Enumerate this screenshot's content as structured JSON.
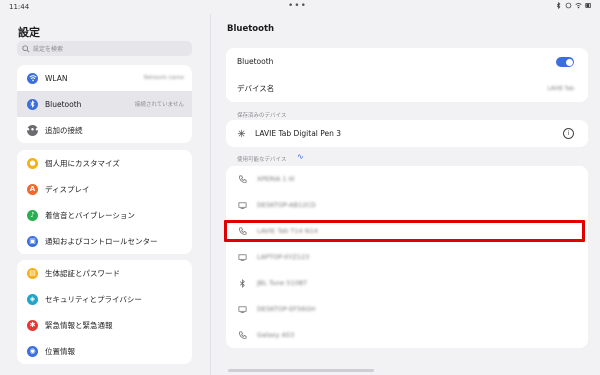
{
  "status": {
    "time": "11:44"
  },
  "sidebar": {
    "title": "設定",
    "search_placeholder": "設定を検索",
    "group1": [
      {
        "label": "WLAN",
        "value": "Network name",
        "icon": "wifi-icon",
        "color": "#3b6fde"
      },
      {
        "label": "Bluetooth",
        "value": "接続されていません",
        "icon": "bluetooth-icon",
        "color": "#3b6fde"
      },
      {
        "label": "追加の接続",
        "value": "",
        "icon": "more-icon",
        "color": "#6c6c70"
      }
    ],
    "group2": [
      {
        "label": "個人用にカスタマイズ",
        "icon": "palette-icon",
        "color": "#f3b01b"
      },
      {
        "label": "ディスプレイ",
        "icon": "display-icon",
        "color": "#f06a30"
      },
      {
        "label": "着信音とバイブレーション",
        "icon": "sound-icon",
        "color": "#27b04f"
      },
      {
        "label": "通知およびコントロールセンター",
        "icon": "notification-icon",
        "color": "#3b6fde"
      }
    ],
    "group3": [
      {
        "label": "生体認証とパスワード",
        "icon": "lock-icon",
        "color": "#f3b01b"
      },
      {
        "label": "セキュリティとプライバシー",
        "icon": "shield-icon",
        "color": "#1ea5c8"
      },
      {
        "label": "緊急情報と緊急通報",
        "icon": "emergency-icon",
        "color": "#e53935"
      },
      {
        "label": "位置情報",
        "icon": "location-icon",
        "color": "#3b6fde"
      }
    ]
  },
  "main": {
    "title": "Bluetooth",
    "bluetooth_label": "Bluetooth",
    "bluetooth_on": true,
    "device_name_label": "デバイス名",
    "device_name_value": "LAVIE Tab",
    "saved_section": "保存済みのデバイス",
    "saved_devices": [
      {
        "name": "LAVIE Tab Digital Pen 3",
        "icon": "pen-icon"
      }
    ],
    "available_section": "使用可能なデバイス",
    "available_devices": [
      {
        "name": "XPERIA 1 III",
        "icon": "phone-icon"
      },
      {
        "name": "DESKTOP-AB12CD",
        "icon": "monitor-icon"
      },
      {
        "name": "LAVIE Tab T14 N14",
        "icon": "phone-icon"
      },
      {
        "name": "LAPTOP-XYZ123",
        "icon": "monitor-icon"
      },
      {
        "name": "JBL Tune 510BT",
        "icon": "bluetooth-icon"
      },
      {
        "name": "DESKTOP-EF56GH",
        "icon": "monitor-icon"
      },
      {
        "name": "Galaxy A53",
        "icon": "phone-icon"
      }
    ]
  },
  "accent": "#3b6fde",
  "highlight_color": "#e00000"
}
